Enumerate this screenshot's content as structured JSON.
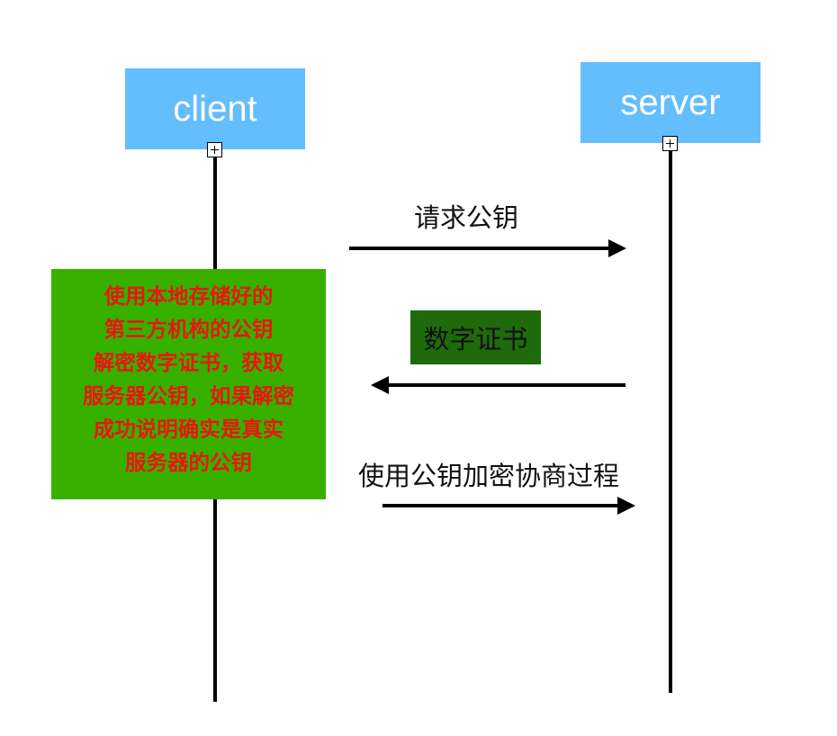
{
  "actors": {
    "client": "client",
    "server": "server"
  },
  "messages": {
    "request_public_key": "请求公钥",
    "negotiate": "使用公钥加密协商过程"
  },
  "certificate_label": "数字证书",
  "note_lines": [
    "使用本地存储好的",
    "第三方机构的公钥",
    "解密数字证书，获取",
    "服务器公钥，如果解密",
    "成功说明确实是真实",
    "服务器的公钥"
  ],
  "colors": {
    "actor_fill": "#64bdfc",
    "note_fill": "#38b000",
    "note_text": "#e8170f",
    "certificate_fill": "#1f6b0c"
  }
}
